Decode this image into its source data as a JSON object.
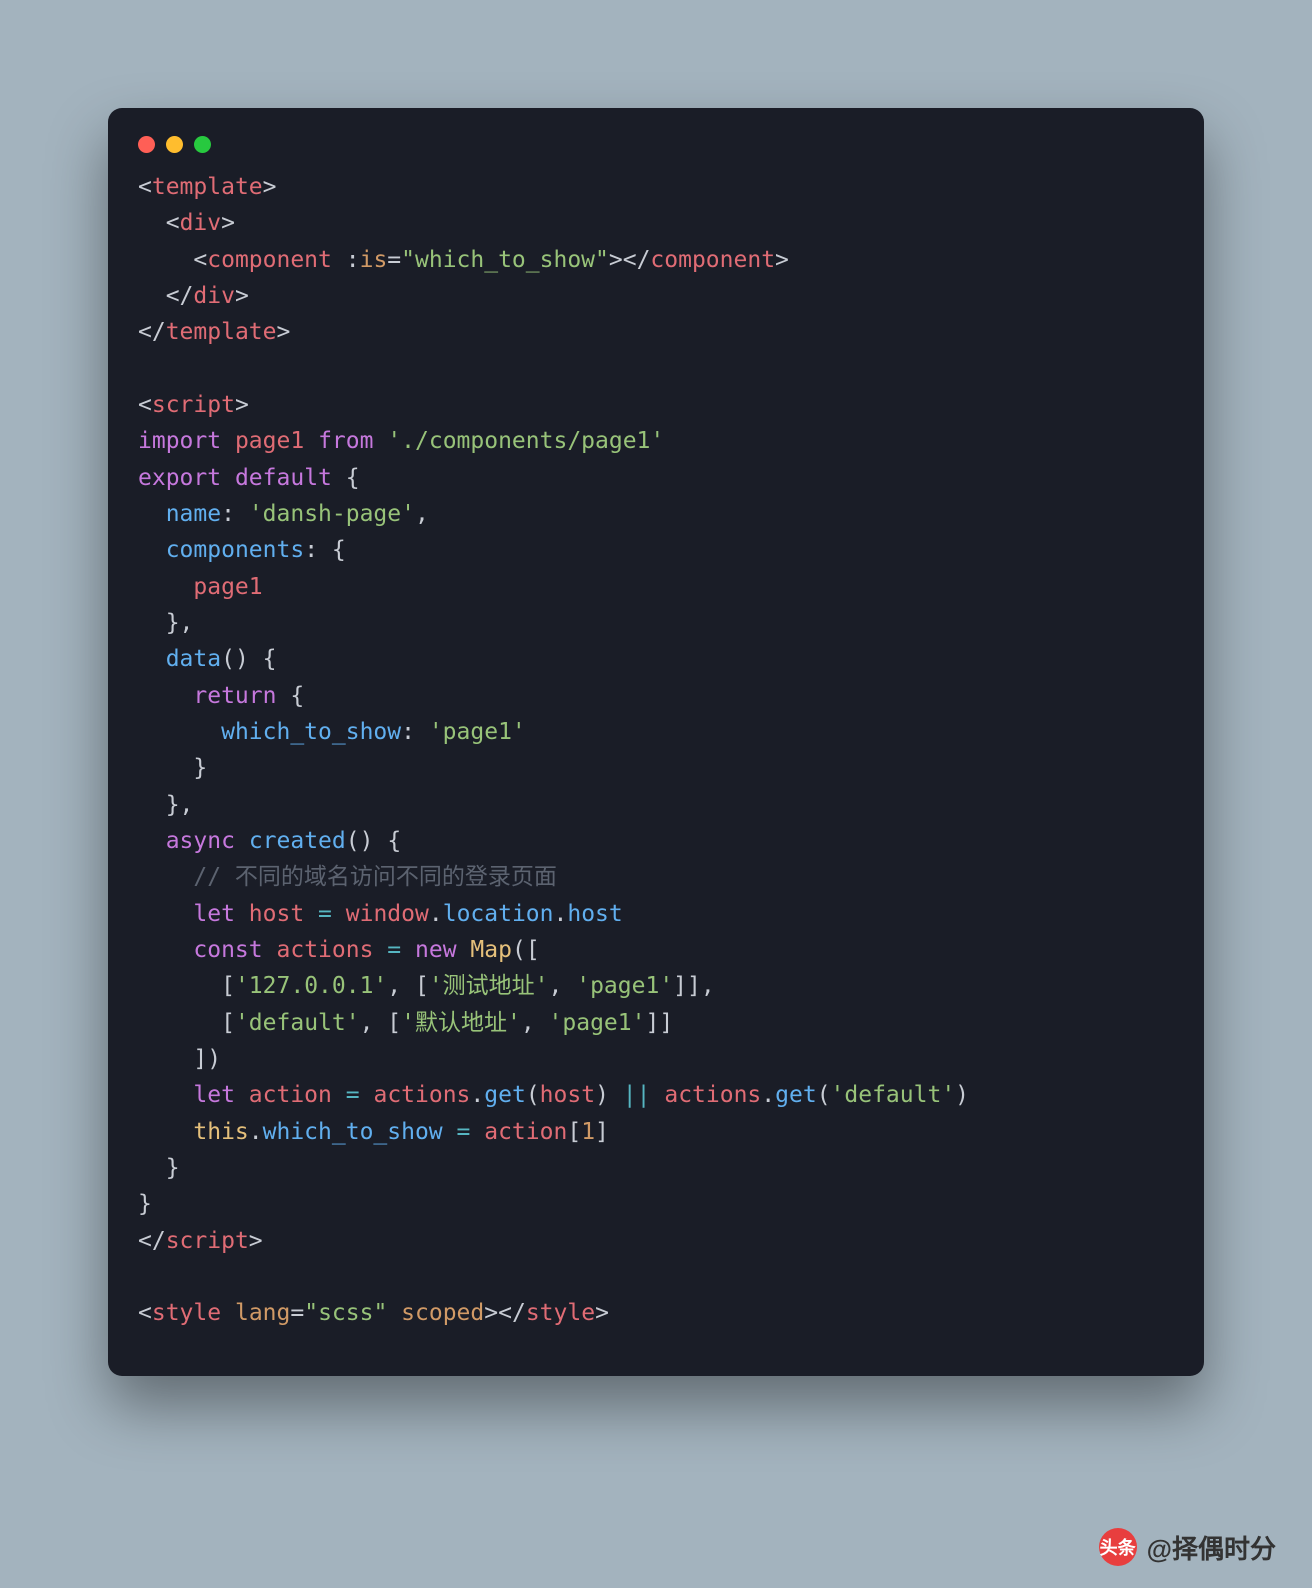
{
  "watermark": {
    "brand": "头条",
    "handle": "@择偶时分"
  },
  "code": {
    "tokens": [
      [
        [
          "punc",
          "<"
        ],
        [
          "tag",
          "template"
        ],
        [
          "punc",
          ">"
        ],
        [
          "nl"
        ]
      ],
      [
        [
          "txt",
          "  "
        ],
        [
          "punc",
          "<"
        ],
        [
          "tag",
          "div"
        ],
        [
          "punc",
          ">"
        ],
        [
          "nl"
        ]
      ],
      [
        [
          "txt",
          "    "
        ],
        [
          "punc",
          "<"
        ],
        [
          "tag",
          "component"
        ],
        [
          "txt",
          " "
        ],
        [
          "punc",
          ":"
        ],
        [
          "attr",
          "is"
        ],
        [
          "punc",
          "="
        ],
        [
          "str",
          "\"which_to_show\""
        ],
        [
          "punc",
          "></"
        ],
        [
          "tag",
          "component"
        ],
        [
          "punc",
          ">"
        ],
        [
          "nl"
        ]
      ],
      [
        [
          "txt",
          "  "
        ],
        [
          "punc",
          "</"
        ],
        [
          "tag",
          "div"
        ],
        [
          "punc",
          ">"
        ],
        [
          "nl"
        ]
      ],
      [
        [
          "punc",
          "</"
        ],
        [
          "tag",
          "template"
        ],
        [
          "punc",
          ">"
        ],
        [
          "nl"
        ]
      ],
      [
        [
          "nl"
        ]
      ],
      [
        [
          "punc",
          "<"
        ],
        [
          "tag",
          "script"
        ],
        [
          "punc",
          ">"
        ],
        [
          "nl"
        ]
      ],
      [
        [
          "kw",
          "import"
        ],
        [
          "txt",
          " "
        ],
        [
          "id",
          "page1"
        ],
        [
          "txt",
          " "
        ],
        [
          "kw",
          "from"
        ],
        [
          "txt",
          " "
        ],
        [
          "str",
          "'./components/page1'"
        ],
        [
          "nl"
        ]
      ],
      [
        [
          "kw",
          "export"
        ],
        [
          "txt",
          " "
        ],
        [
          "kw",
          "default"
        ],
        [
          "txt",
          " "
        ],
        [
          "punc",
          "{"
        ],
        [
          "nl"
        ]
      ],
      [
        [
          "txt",
          "  "
        ],
        [
          "prop",
          "name"
        ],
        [
          "punc",
          ":"
        ],
        [
          "txt",
          " "
        ],
        [
          "str",
          "'dansh-page'"
        ],
        [
          "punc",
          ","
        ],
        [
          "nl"
        ]
      ],
      [
        [
          "txt",
          "  "
        ],
        [
          "prop",
          "components"
        ],
        [
          "punc",
          ":"
        ],
        [
          "txt",
          " "
        ],
        [
          "punc",
          "{"
        ],
        [
          "nl"
        ]
      ],
      [
        [
          "txt",
          "    "
        ],
        [
          "id",
          "page1"
        ],
        [
          "nl"
        ]
      ],
      [
        [
          "txt",
          "  "
        ],
        [
          "punc",
          "},"
        ],
        [
          "nl"
        ]
      ],
      [
        [
          "txt",
          "  "
        ],
        [
          "func",
          "data"
        ],
        [
          "punc",
          "()"
        ],
        [
          "txt",
          " "
        ],
        [
          "punc",
          "{"
        ],
        [
          "nl"
        ]
      ],
      [
        [
          "txt",
          "    "
        ],
        [
          "kw",
          "return"
        ],
        [
          "txt",
          " "
        ],
        [
          "punc",
          "{"
        ],
        [
          "nl"
        ]
      ],
      [
        [
          "txt",
          "      "
        ],
        [
          "prop",
          "which_to_show"
        ],
        [
          "punc",
          ":"
        ],
        [
          "txt",
          " "
        ],
        [
          "str",
          "'page1'"
        ],
        [
          "nl"
        ]
      ],
      [
        [
          "txt",
          "    "
        ],
        [
          "punc",
          "}"
        ],
        [
          "nl"
        ]
      ],
      [
        [
          "txt",
          "  "
        ],
        [
          "punc",
          "},"
        ],
        [
          "nl"
        ]
      ],
      [
        [
          "txt",
          "  "
        ],
        [
          "kw",
          "async"
        ],
        [
          "txt",
          " "
        ],
        [
          "func",
          "created"
        ],
        [
          "punc",
          "()"
        ],
        [
          "txt",
          " "
        ],
        [
          "punc",
          "{"
        ],
        [
          "nl"
        ]
      ],
      [
        [
          "txt",
          "    "
        ],
        [
          "com",
          "// 不同的域名访问不同的登录页面"
        ],
        [
          "nl"
        ]
      ],
      [
        [
          "txt",
          "    "
        ],
        [
          "kw",
          "let"
        ],
        [
          "txt",
          " "
        ],
        [
          "id",
          "host"
        ],
        [
          "txt",
          " "
        ],
        [
          "op",
          "="
        ],
        [
          "txt",
          " "
        ],
        [
          "id",
          "window"
        ],
        [
          "punc",
          "."
        ],
        [
          "prop",
          "location"
        ],
        [
          "punc",
          "."
        ],
        [
          "prop",
          "host"
        ],
        [
          "nl"
        ]
      ],
      [
        [
          "txt",
          "    "
        ],
        [
          "kw",
          "const"
        ],
        [
          "txt",
          " "
        ],
        [
          "id",
          "actions"
        ],
        [
          "txt",
          " "
        ],
        [
          "op",
          "="
        ],
        [
          "txt",
          " "
        ],
        [
          "kw",
          "new"
        ],
        [
          "txt",
          " "
        ],
        [
          "class",
          "Map"
        ],
        [
          "punc",
          "(["
        ],
        [
          "nl"
        ]
      ],
      [
        [
          "txt",
          "      "
        ],
        [
          "punc",
          "["
        ],
        [
          "str",
          "'127.0.0.1'"
        ],
        [
          "punc",
          ", ["
        ],
        [
          "str",
          "'测试地址'"
        ],
        [
          "punc",
          ", "
        ],
        [
          "str",
          "'page1'"
        ],
        [
          "punc",
          "]],"
        ],
        [
          "nl"
        ]
      ],
      [
        [
          "txt",
          "      "
        ],
        [
          "punc",
          "["
        ],
        [
          "str",
          "'default'"
        ],
        [
          "punc",
          ", ["
        ],
        [
          "str",
          "'默认地址'"
        ],
        [
          "punc",
          ", "
        ],
        [
          "str",
          "'page1'"
        ],
        [
          "punc",
          "]]"
        ],
        [
          "nl"
        ]
      ],
      [
        [
          "txt",
          "    "
        ],
        [
          "punc",
          "])"
        ],
        [
          "nl"
        ]
      ],
      [
        [
          "txt",
          "    "
        ],
        [
          "kw",
          "let"
        ],
        [
          "txt",
          " "
        ],
        [
          "id",
          "action"
        ],
        [
          "txt",
          " "
        ],
        [
          "op",
          "="
        ],
        [
          "txt",
          " "
        ],
        [
          "id",
          "actions"
        ],
        [
          "punc",
          "."
        ],
        [
          "func",
          "get"
        ],
        [
          "punc",
          "("
        ],
        [
          "id",
          "host"
        ],
        [
          "punc",
          ")"
        ],
        [
          "txt",
          " "
        ],
        [
          "op",
          "||"
        ],
        [
          "txt",
          " "
        ],
        [
          "id",
          "actions"
        ],
        [
          "punc",
          "."
        ],
        [
          "func",
          "get"
        ],
        [
          "punc",
          "("
        ],
        [
          "str",
          "'default'"
        ],
        [
          "punc",
          ")"
        ],
        [
          "nl"
        ]
      ],
      [
        [
          "txt",
          "    "
        ],
        [
          "this",
          "this"
        ],
        [
          "punc",
          "."
        ],
        [
          "prop",
          "which_to_show"
        ],
        [
          "txt",
          " "
        ],
        [
          "op",
          "="
        ],
        [
          "txt",
          " "
        ],
        [
          "id",
          "action"
        ],
        [
          "punc",
          "["
        ],
        [
          "num",
          "1"
        ],
        [
          "punc",
          "]"
        ],
        [
          "nl"
        ]
      ],
      [
        [
          "txt",
          "  "
        ],
        [
          "punc",
          "}"
        ],
        [
          "nl"
        ]
      ],
      [
        [
          "punc",
          "}"
        ],
        [
          "nl"
        ]
      ],
      [
        [
          "punc",
          "</"
        ],
        [
          "tag",
          "script"
        ],
        [
          "punc",
          ">"
        ],
        [
          "nl"
        ]
      ],
      [
        [
          "nl"
        ]
      ],
      [
        [
          "punc",
          "<"
        ],
        [
          "tag",
          "style"
        ],
        [
          "txt",
          " "
        ],
        [
          "attr",
          "lang"
        ],
        [
          "punc",
          "="
        ],
        [
          "str",
          "\"scss\""
        ],
        [
          "txt",
          " "
        ],
        [
          "attr",
          "scoped"
        ],
        [
          "punc",
          "></"
        ],
        [
          "tag",
          "style"
        ],
        [
          "punc",
          ">"
        ],
        [
          "nl"
        ]
      ]
    ]
  }
}
